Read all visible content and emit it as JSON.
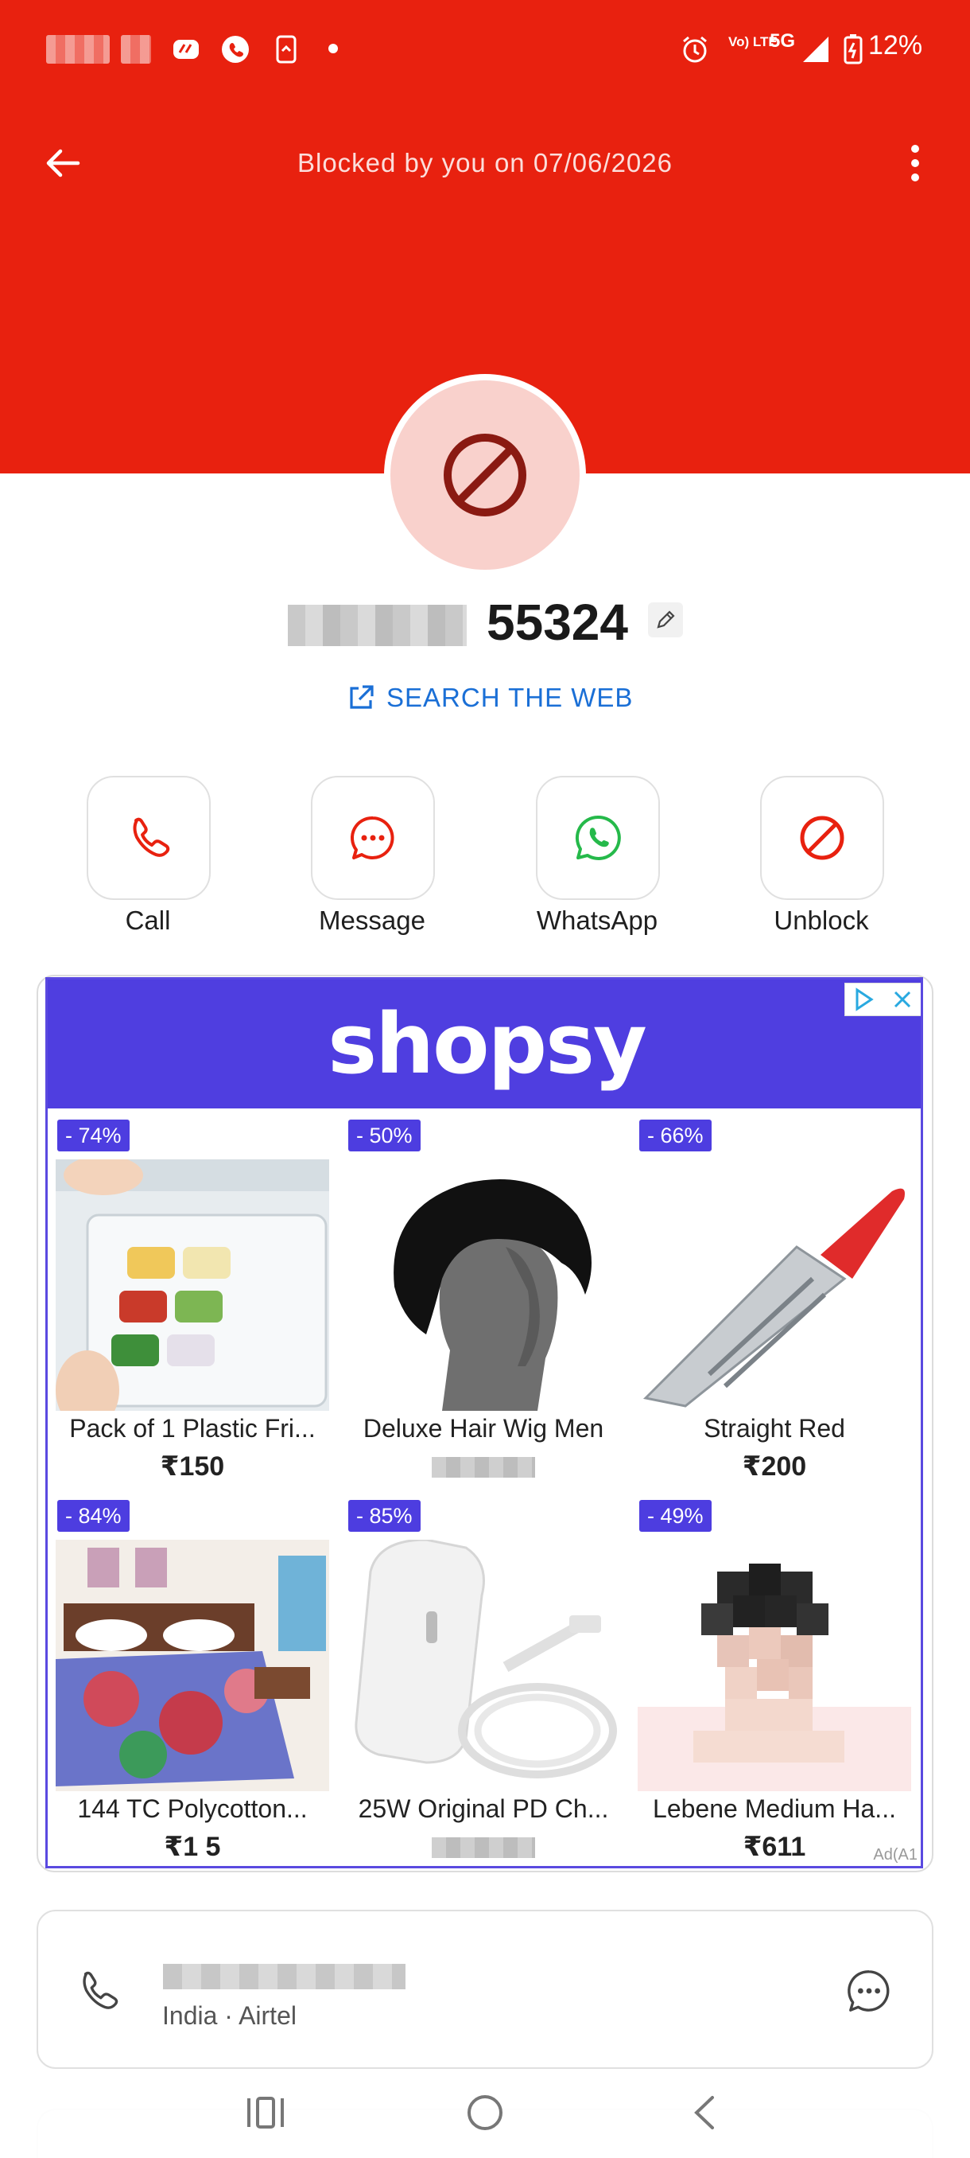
{
  "status_bar": {
    "battery": "12%",
    "network": "5G",
    "volte": "Vo) LTE"
  },
  "header": {
    "blocked_text": "Blocked by you on 07/06/2026",
    "bg_color": "#e8210f"
  },
  "contact": {
    "number_visible": "55324",
    "search_web_label": "SEARCH THE WEB"
  },
  "actions": [
    {
      "label": "Call",
      "icon": "phone-icon"
    },
    {
      "label": "Message",
      "icon": "message-icon"
    },
    {
      "label": "WhatsApp",
      "icon": "whatsapp-icon"
    },
    {
      "label": "Unblock",
      "icon": "block-icon"
    }
  ],
  "ad": {
    "brand": "shopsy",
    "ad_label": "Ad(A1",
    "products": [
      {
        "badge": "- 74%",
        "name": "Pack of 1 Plastic Fri...",
        "price": "₹150",
        "image": "fridge-organizer"
      },
      {
        "badge": "- 50%",
        "name": "Deluxe Hair Wig Men",
        "price": "",
        "image": "hair-wig"
      },
      {
        "badge": "- 66%",
        "name": "Straight Red",
        "price": "₹200",
        "image": "knife"
      },
      {
        "badge": "- 84%",
        "name": "144 TC Polycotton...",
        "price": "₹1 5",
        "image": "bedsheet"
      },
      {
        "badge": "- 85%",
        "name": "25W Original PD Ch...",
        "price": "",
        "image": "charger"
      },
      {
        "badge": "- 49%",
        "name": "Lebene Medium Ha...",
        "price": "₹611",
        "image": "hair-model"
      }
    ]
  },
  "call_log": {
    "subtitle": "India · Airtel"
  }
}
